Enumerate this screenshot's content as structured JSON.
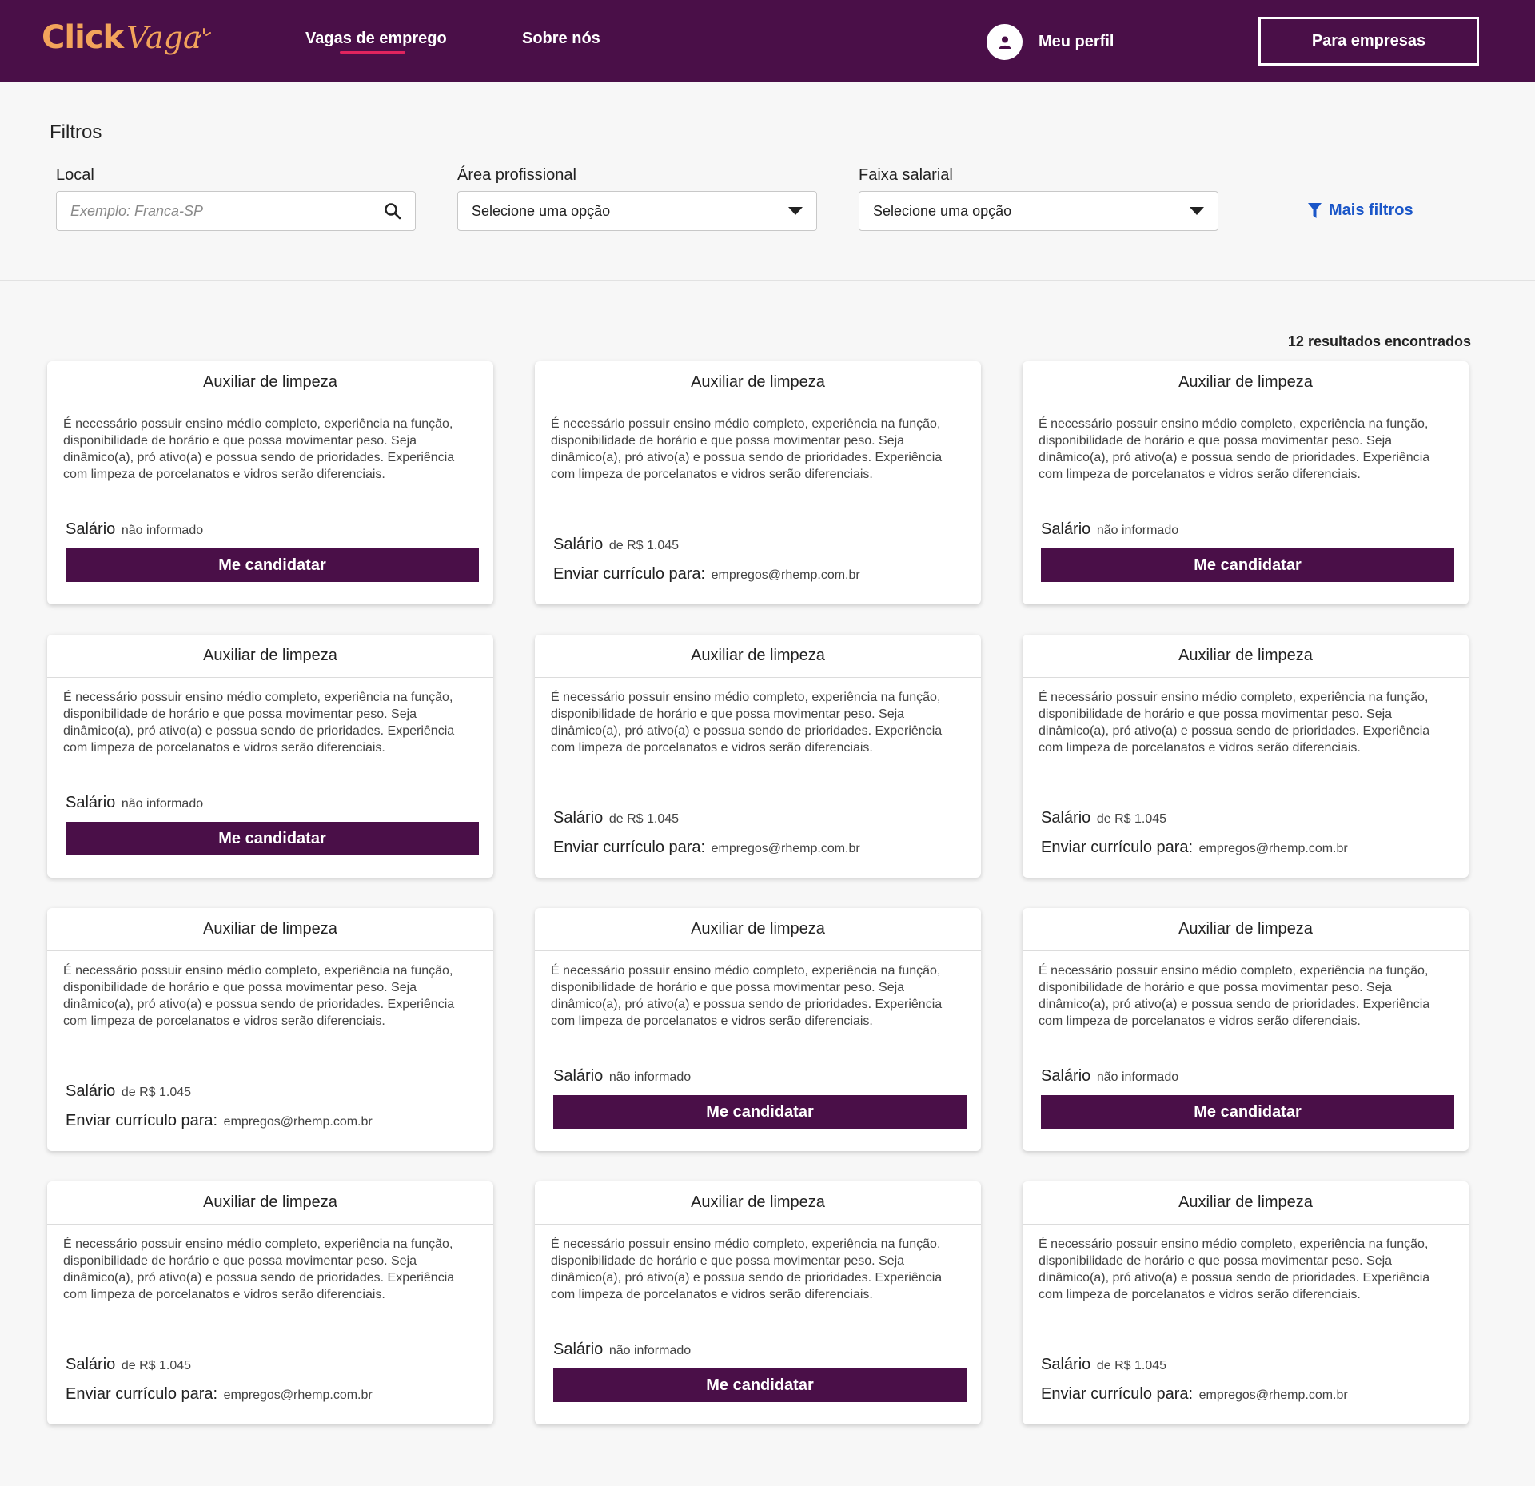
{
  "header": {
    "logo_click": "Click",
    "logo_vaga": "Vaga",
    "nav_jobs": "Vagas de emprego",
    "nav_about": "Sobre nós",
    "profile_label": "Meu perfil",
    "companies_button": "Para empresas",
    "background_color": "#4a0f48",
    "logo_color": "#f2a35b",
    "active_underline_color": "#e0245e"
  },
  "filters": {
    "title": "Filtros",
    "location": {
      "label": "Local",
      "placeholder": "Exemplo: Franca-SP"
    },
    "area": {
      "label": "Área profissional",
      "value": "Selecione uma opção"
    },
    "salary": {
      "label": "Faixa salarial",
      "value": "Selecione uma opção"
    },
    "more_filters": "Mais filtros",
    "more_filters_color": "#1a56c8"
  },
  "results": {
    "count_text": "12 resultados encontrados"
  },
  "jobs": [
    {
      "title": "Auxiliar de limpeza",
      "description": "É necessário possuir ensino médio completo, experiência na função, disponibilidade de horário e que possa movimentar peso. Seja dinâmico(a), pró ativo(a) e possua sendo de prioridades. Experiência com limpeza de porcelanatos e vidros serão diferenciais.",
      "salary_label": "Salário",
      "salary_value": "não informado",
      "action": "Me candidatar"
    },
    {
      "title": "Auxiliar de limpeza",
      "description": "É necessário possuir ensino médio completo, experiência na função, disponibilidade de horário e que possa movimentar peso. Seja dinâmico(a), pró ativo(a) e possua sendo de prioridades. Experiência com limpeza de porcelanatos e vidros serão diferenciais.",
      "salary_label": "Salário",
      "salary_value": "de R$ 1.045",
      "email_label": "Enviar currículo para:",
      "email": "empregos@rhemp.com.br"
    },
    {
      "title": "Auxiliar de limpeza",
      "description": "É necessário possuir ensino médio completo, experiência na função, disponibilidade de horário e que possa movimentar peso. Seja dinâmico(a), pró ativo(a) e possua sendo de prioridades. Experiência com limpeza de porcelanatos e vidros serão diferenciais.",
      "salary_label": "Salário",
      "salary_value": "não informado",
      "action": "Me candidatar"
    },
    {
      "title": "Auxiliar de limpeza",
      "description": "É necessário possuir ensino médio completo, experiência na função, disponibilidade de horário e que possa movimentar peso. Seja dinâmico(a), pró ativo(a) e possua sendo de prioridades. Experiência com limpeza de porcelanatos e vidros serão diferenciais.",
      "salary_label": "Salário",
      "salary_value": "não informado",
      "action": "Me candidatar"
    },
    {
      "title": "Auxiliar de limpeza",
      "description": "É necessário possuir ensino médio completo, experiência na função, disponibilidade de horário e que possa movimentar peso. Seja dinâmico(a), pró ativo(a) e possua sendo de prioridades. Experiência com limpeza de porcelanatos e vidros serão diferenciais.",
      "salary_label": "Salário",
      "salary_value": "de R$ 1.045",
      "email_label": "Enviar currículo para:",
      "email": "empregos@rhemp.com.br"
    },
    {
      "title": "Auxiliar de limpeza",
      "description": "É necessário possuir ensino médio completo, experiência na função, disponibilidade de horário e que possa movimentar peso. Seja dinâmico(a), pró ativo(a) e possua sendo de prioridades. Experiência com limpeza de porcelanatos e vidros serão diferenciais.",
      "salary_label": "Salário",
      "salary_value": "de R$ 1.045",
      "email_label": "Enviar currículo para:",
      "email": "empregos@rhemp.com.br"
    },
    {
      "title": "Auxiliar de limpeza",
      "description": "É necessário possuir ensino médio completo, experiência na função, disponibilidade de horário e que possa movimentar peso. Seja dinâmico(a), pró ativo(a) e possua sendo de prioridades. Experiência com limpeza de porcelanatos e vidros serão diferenciais.",
      "salary_label": "Salário",
      "salary_value": "de R$ 1.045",
      "email_label": "Enviar currículo para:",
      "email": "empregos@rhemp.com.br"
    },
    {
      "title": "Auxiliar de limpeza",
      "description": "É necessário possuir ensino médio completo, experiência na função, disponibilidade de horário e que possa movimentar peso. Seja dinâmico(a), pró ativo(a) e possua sendo de prioridades. Experiência com limpeza de porcelanatos e vidros serão diferenciais.",
      "salary_label": "Salário",
      "salary_value": "não informado",
      "action": "Me candidatar"
    },
    {
      "title": "Auxiliar de limpeza",
      "description": "É necessário possuir ensino médio completo, experiência na função, disponibilidade de horário e que possa movimentar peso. Seja dinâmico(a), pró ativo(a) e possua sendo de prioridades. Experiência com limpeza de porcelanatos e vidros serão diferenciais.",
      "salary_label": "Salário",
      "salary_value": "não informado",
      "action": "Me candidatar"
    },
    {
      "title": "Auxiliar de limpeza",
      "description": "É necessário possuir ensino médio completo, experiência na função, disponibilidade de horário e que possa movimentar peso. Seja dinâmico(a), pró ativo(a) e possua sendo de prioridades. Experiência com limpeza de porcelanatos e vidros serão diferenciais.",
      "salary_label": "Salário",
      "salary_value": "de R$ 1.045",
      "email_label": "Enviar currículo para:",
      "email": "empregos@rhemp.com.br"
    },
    {
      "title": "Auxiliar de limpeza",
      "description": "É necessário possuir ensino médio completo, experiência na função, disponibilidade de horário e que possa movimentar peso. Seja dinâmico(a), pró ativo(a) e possua sendo de prioridades. Experiência com limpeza de porcelanatos e vidros serão diferenciais.",
      "salary_label": "Salário",
      "salary_value": "não informado",
      "action": "Me candidatar"
    },
    {
      "title": "Auxiliar de limpeza",
      "description": "É necessário possuir ensino médio completo, experiência na função, disponibilidade de horário e que possa movimentar peso. Seja dinâmico(a), pró ativo(a) e possua sendo de prioridades. Experiência com limpeza de porcelanatos e vidros serão diferenciais.",
      "salary_label": "Salário",
      "salary_value": "de R$ 1.045",
      "email_label": "Enviar currículo para:",
      "email": "empregos@rhemp.com.br"
    }
  ]
}
